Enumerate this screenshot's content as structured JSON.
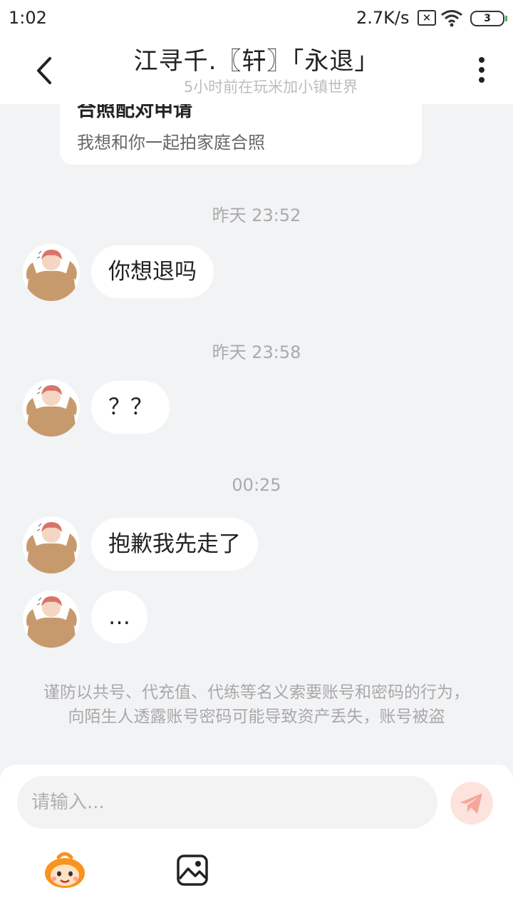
{
  "status_bar": {
    "time": "1:02",
    "network_speed": "2.7K/s",
    "battery_level": "3"
  },
  "header": {
    "title": "江寻千.〖轩〗「永退」",
    "subtitle": "5小时前在玩米加小镇世界"
  },
  "invite_card": {
    "title": "合照配对申请",
    "description": "我想和你一起拍家庭合照"
  },
  "messages": [
    {
      "timestamp": "昨天 23:52",
      "text": "你想退吗"
    },
    {
      "timestamp": "昨天 23:58",
      "text": "？？"
    },
    {
      "timestamp": "00:25",
      "text": "抱歉我先走了"
    },
    {
      "timestamp": "",
      "text": "…"
    }
  ],
  "notice": "谨防以共号、代充值、代练等名义索要账号和密码的行为，向陌生人透露账号密码可能导致资产丢失，账号被盗",
  "composer": {
    "placeholder": "请输入...",
    "value": ""
  },
  "icons": {
    "back": "chevron-left-icon",
    "more": "more-vertical-icon",
    "send": "paper-plane-icon",
    "emoji": "mascot-emoji-icon",
    "image": "image-icon"
  },
  "colors": {
    "background": "#f2f3f5",
    "bubble": "#ffffff",
    "send_button": "#fde3de",
    "send_icon": "#f6a79b",
    "emoji_orange": "#f7931e"
  }
}
